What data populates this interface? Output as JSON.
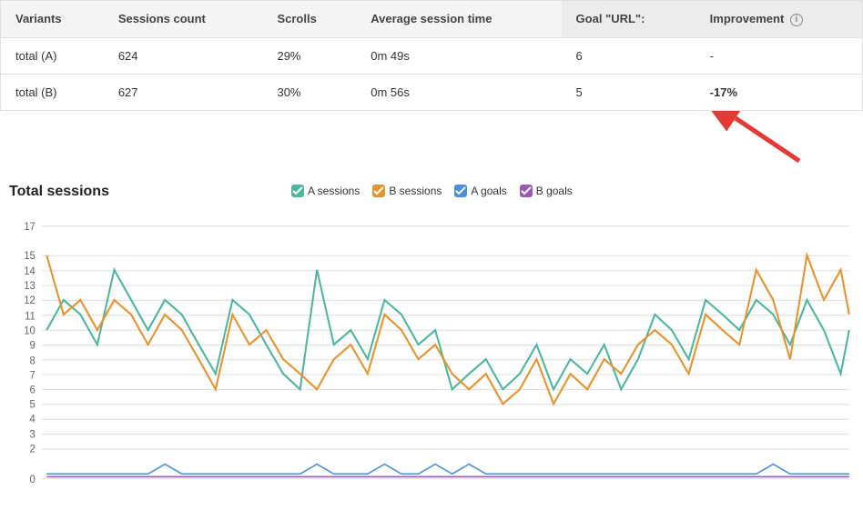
{
  "table": {
    "headers": [
      "Variants",
      "Sessions count",
      "Scrolls",
      "Average session time",
      "Goal \"URL\":",
      "Improvement"
    ],
    "rows": [
      {
        "variant": "total (A)",
        "sessions": "624",
        "scrolls": "29%",
        "avg_time": "0m 49s",
        "goal": "6",
        "improvement": "-"
      },
      {
        "variant": "total (B)",
        "sessions": "627",
        "scrolls": "30%",
        "avg_time": "0m 56s",
        "goal": "5",
        "improvement": "-17%"
      }
    ]
  },
  "chart": {
    "title": "Total sessions",
    "legend": [
      {
        "label": "A sessions",
        "color": "#4db6a0"
      },
      {
        "label": "B sessions",
        "color": "#e8922d"
      },
      {
        "label": "A goals",
        "color": "#4a90d9"
      },
      {
        "label": "B goals",
        "color": "#9b59b6"
      }
    ],
    "y_labels": [
      "0",
      "2",
      "3",
      "4",
      "5",
      "6",
      "7",
      "8",
      "9",
      "10",
      "11",
      "12",
      "13",
      "14",
      "15",
      "17"
    ],
    "y_max": 17,
    "y_min": 0
  }
}
